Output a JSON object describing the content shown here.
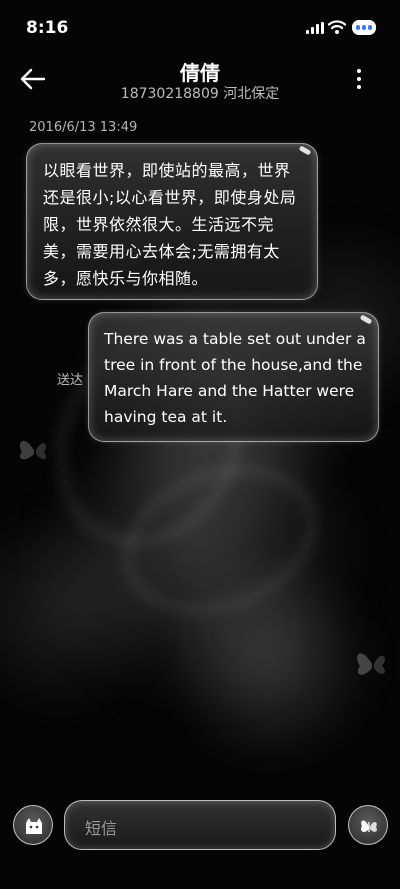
{
  "status_bar": {
    "time": "8:16",
    "icons": [
      "signal-icon",
      "wifi-icon",
      "battery-icon"
    ]
  },
  "header": {
    "back_icon": "arrow-left-icon",
    "contact_name": "倩倩",
    "contact_detail": "18730218809 河北保定",
    "menu_icon": "more-vertical-icon"
  },
  "conversation": {
    "timestamp": "2016/6/13 13:49",
    "messages": [
      {
        "direction": "incoming",
        "text": "以眼看世界，即使站的最高，世界还是很小;以心看世界，即使身处局限，世界依然很大。生活远不完美，需要用心去体会;无需拥有太多，愿快乐与你相随。"
      },
      {
        "direction": "outgoing",
        "status": "送达",
        "text": "There was a table set out under a tree in front of the house,and the March Hare and the Hatter were having tea at it."
      }
    ]
  },
  "composer": {
    "left_icon": "cat-icon",
    "placeholder": "短信",
    "send_icon": "butterfly-icon"
  },
  "colors": {
    "background": "#000000",
    "bubble_fill": "#2e2e2e",
    "bubble_border": "#e0e0e0",
    "secondary_text": "#bdbdbd",
    "battery_accent": "#3b78ff"
  }
}
